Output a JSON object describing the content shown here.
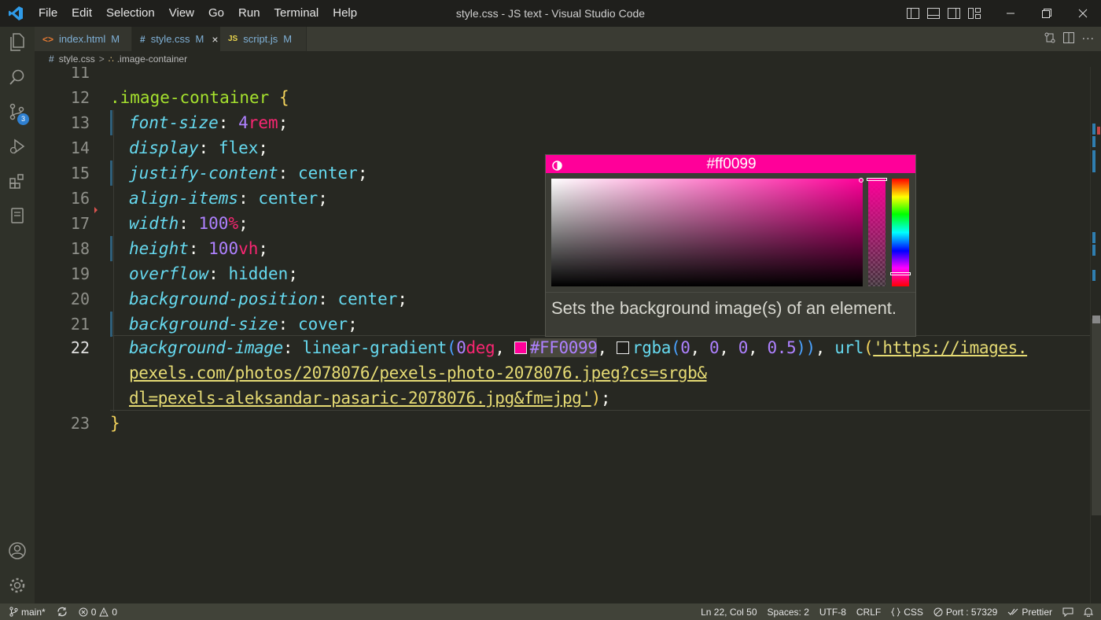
{
  "titlebar": {
    "menu": [
      "File",
      "Edit",
      "Selection",
      "View",
      "Go",
      "Run",
      "Terminal",
      "Help"
    ],
    "title": "style.css - JS text - Visual Studio Code"
  },
  "activity": {
    "items": [
      "explorer-icon",
      "search-icon",
      "source-control-icon",
      "run-debug-icon",
      "extensions-icon",
      "remote-icon"
    ],
    "source_control_badge": "3",
    "bottom": [
      "account-icon",
      "settings-gear-icon"
    ]
  },
  "tabs": [
    {
      "icon": "<>",
      "name": "index.html",
      "modified": "M",
      "active": false
    },
    {
      "icon": "#",
      "name": "style.css",
      "modified": "M",
      "active": true,
      "close": "×"
    },
    {
      "icon": "JS",
      "name": "script.js",
      "modified": "M",
      "active": false
    }
  ],
  "breadcrumb": {
    "file_icon": "#",
    "file": "style.css",
    "separator": ">",
    "symbol": ".image-container"
  },
  "editor": {
    "line_numbers": [
      "11",
      "12",
      "13",
      "14",
      "15",
      "16",
      "17",
      "18",
      "19",
      "20",
      "21",
      "22",
      "23"
    ],
    "current_line": "22",
    "code": {
      "l12_selector": ".image-container",
      "l12_brace": "{",
      "l13_prop": "font-size",
      "l13_num": "4",
      "l13_unit": "rem",
      "l14_prop": "display",
      "l14_val": "flex",
      "l15_prop": "justify-content",
      "l15_val": "center",
      "l16_prop": "align-items",
      "l16_val": "center",
      "l17_prop": "width",
      "l17_num": "100",
      "l17_unit": "%",
      "l18_prop": "height",
      "l18_num": "100",
      "l18_unit": "vh",
      "l19_prop": "overflow",
      "l19_val": "hidden",
      "l20_prop": "background-position",
      "l20_val": "center",
      "l21_prop": "background-size",
      "l21_val": "cover",
      "l22_prop": "background-image",
      "l22_func": "linear-gradient",
      "l22_num": "0",
      "l22_unit": "deg",
      "l22_hex": "#FF0099",
      "l22_rgba": "rgba",
      "l22_rgba_args": [
        "0",
        "0",
        "0",
        "0.5"
      ],
      "l22_url": "url",
      "l22_str1": "'https://images.",
      "l22_str2": "pexels.com/photos/2078076/pexels-photo-2078076.jpeg?cs=srgb&",
      "l22_str3": "dl=pexels-aleksandar-pasaric-2078076.jpg&fm=jpg'",
      "l23_brace": "}"
    }
  },
  "color_picker": {
    "hex": "#ff0099",
    "color": "#ff0099",
    "hover_text": "Sets the background image(s) of an element."
  },
  "statusbar": {
    "branch": "main*",
    "errors": "0",
    "warnings": "0",
    "position": "Ln 22, Col 50",
    "spaces": "Spaces: 2",
    "encoding": "UTF-8",
    "eol": "CRLF",
    "language": "CSS",
    "port": "Port : 57329",
    "formatter": "Prettier"
  },
  "colors": {
    "accent": "#ff0099",
    "badge": "#2f80d1",
    "background": "#272822"
  }
}
